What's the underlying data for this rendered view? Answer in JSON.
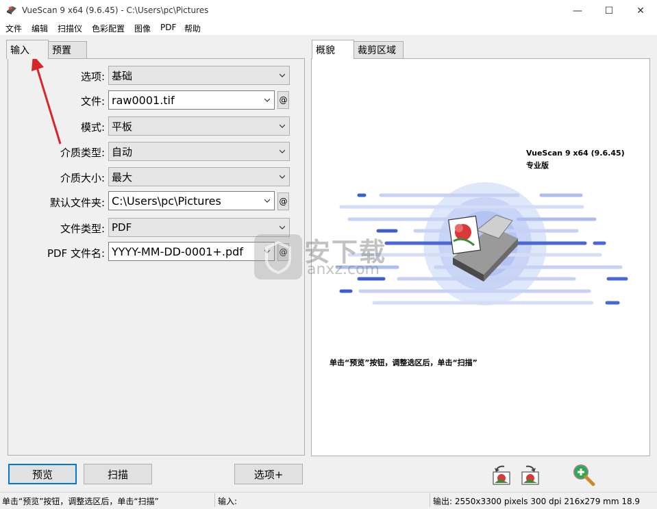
{
  "window": {
    "title": "VueScan 9 x64 (9.6.45) - C:\\Users\\pc\\Pictures",
    "minimize": "—",
    "maximize": "☐",
    "close": "✕"
  },
  "menu": [
    "文件",
    "编辑",
    "扫描仪",
    "色彩配置",
    "图像",
    "PDF",
    "帮助"
  ],
  "left_tabs": [
    "输入",
    "预置"
  ],
  "right_tabs": [
    "概貌",
    "裁剪区域"
  ],
  "form": {
    "rows": [
      {
        "label": "选项:",
        "value": "基础"
      },
      {
        "label": "文件:",
        "value": "raw0001.tif"
      },
      {
        "label": "模式:",
        "value": "平板"
      },
      {
        "label": "介质类型:",
        "value": "自动"
      },
      {
        "label": "介质大小:",
        "value": "最大"
      },
      {
        "label": "默认文件夹:",
        "value": "C:\\Users\\pc\\Pictures"
      },
      {
        "label": "文件类型:",
        "value": "PDF"
      },
      {
        "label": "PDF 文件名:",
        "value": "YYYY-MM-DD-0001+.pdf"
      }
    ],
    "at_label": "@"
  },
  "preview": {
    "app_name": "VueScan 9 x64 (9.6.45)",
    "edition": "专业版",
    "hint": "单击“预览”按钮，调整选区后，单击“扫描”"
  },
  "watermark": {
    "text": "安下载",
    "domain": "anxz.com"
  },
  "buttons": {
    "preview": "预览",
    "scan": "扫描",
    "options_plus": "选项+"
  },
  "status": {
    "hint": "单击“预览”按钮，调整选区后，单击“扫描”",
    "input": "输入:",
    "output": "输出: 2550x3300 pixels 300 dpi 216x279 mm 18.9"
  },
  "colors": {
    "accent": "#0078d7",
    "arrow": "#d9242b",
    "scanner_lines": "#3f5fcf"
  },
  "icons": [
    "app-icon",
    "chevron-down-icon",
    "rotate-left-icon",
    "rotate-right-icon",
    "zoom-in-icon",
    "red-arrow-annotation"
  ]
}
